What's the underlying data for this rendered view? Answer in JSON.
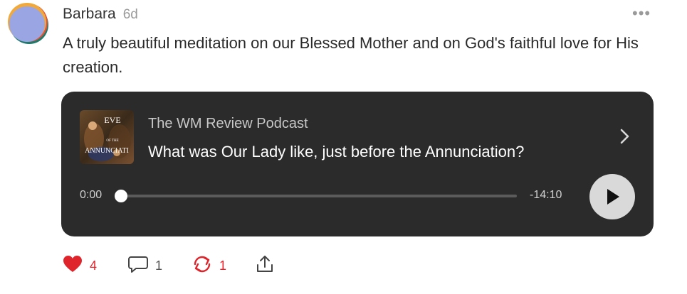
{
  "comment": {
    "author": "Barbara",
    "age": "6d",
    "text": "A truly beautiful meditation on our Blessed Mother and on God's faithful love for His creation.",
    "avatar_colors": [
      "#f0a93a",
      "#1e7a6a",
      "#e2533a",
      "#9aa6e4"
    ]
  },
  "player": {
    "podcast_name": "The WM Review Podcast",
    "episode_title": "What was Our Lady like, just before the Annunciation?",
    "cover_text_top": "EVE",
    "cover_text_mid": "OF THE",
    "cover_text_bottom": "ANNUNCIATI",
    "time_current": "0:00",
    "time_remaining": "-14:10",
    "progress": 0,
    "background": "#2b2b2b"
  },
  "actions": {
    "like_count": "4",
    "reply_count": "1",
    "restack_count": "1",
    "like_color": "#e0242b",
    "restack_color": "#e0242b"
  },
  "icons": [
    "more-icon",
    "chevron-right-icon",
    "play-icon",
    "heart-icon",
    "comment-icon",
    "restack-icon",
    "share-icon"
  ]
}
